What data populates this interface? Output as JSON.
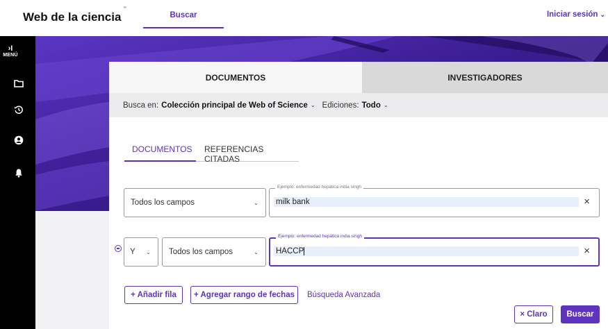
{
  "header": {
    "brand": "Web de la ciencia",
    "brand_tm": "™",
    "tab_search": "Buscar",
    "signin": "Iniciar sesión",
    "signin_icon": "chevron-down-icon"
  },
  "rail": {
    "menu_arrow": "›I",
    "menu_label": "MENÚ",
    "icons": [
      "folder-icon",
      "history-icon",
      "account-icon",
      "bell-icon"
    ]
  },
  "card": {
    "tabs": [
      "DOCUMENTOS",
      "INVESTIGADORES"
    ],
    "scope": {
      "prefix": "Busca en:",
      "collection": "Colección principal de Web of Science",
      "editions_prefix": "Ediciones:",
      "editions_value": "Todo"
    },
    "subtabs": [
      "DOCUMENTOS",
      "REFERENCIAS CITADAS"
    ],
    "rows": [
      {
        "field_select": "Todos los campos",
        "placeholder": "Ejemplo: enfermedad hepática india singh",
        "value": "milk bank"
      },
      {
        "operator": "Y",
        "field_select": "Todos los campos",
        "placeholder": "Ejemplo: enfermedad hepática india singh",
        "value": "HACCP"
      }
    ],
    "actions": {
      "add_row": "+ Añadir fila",
      "add_date_range": "+ Agregar rango de fechas",
      "advanced": "Búsqueda Avanzada",
      "clear": "× Claro",
      "search": "Buscar"
    }
  },
  "colors": {
    "accent": "#5e33bf",
    "rail": "#000000",
    "hero": "#3a1d8a"
  }
}
